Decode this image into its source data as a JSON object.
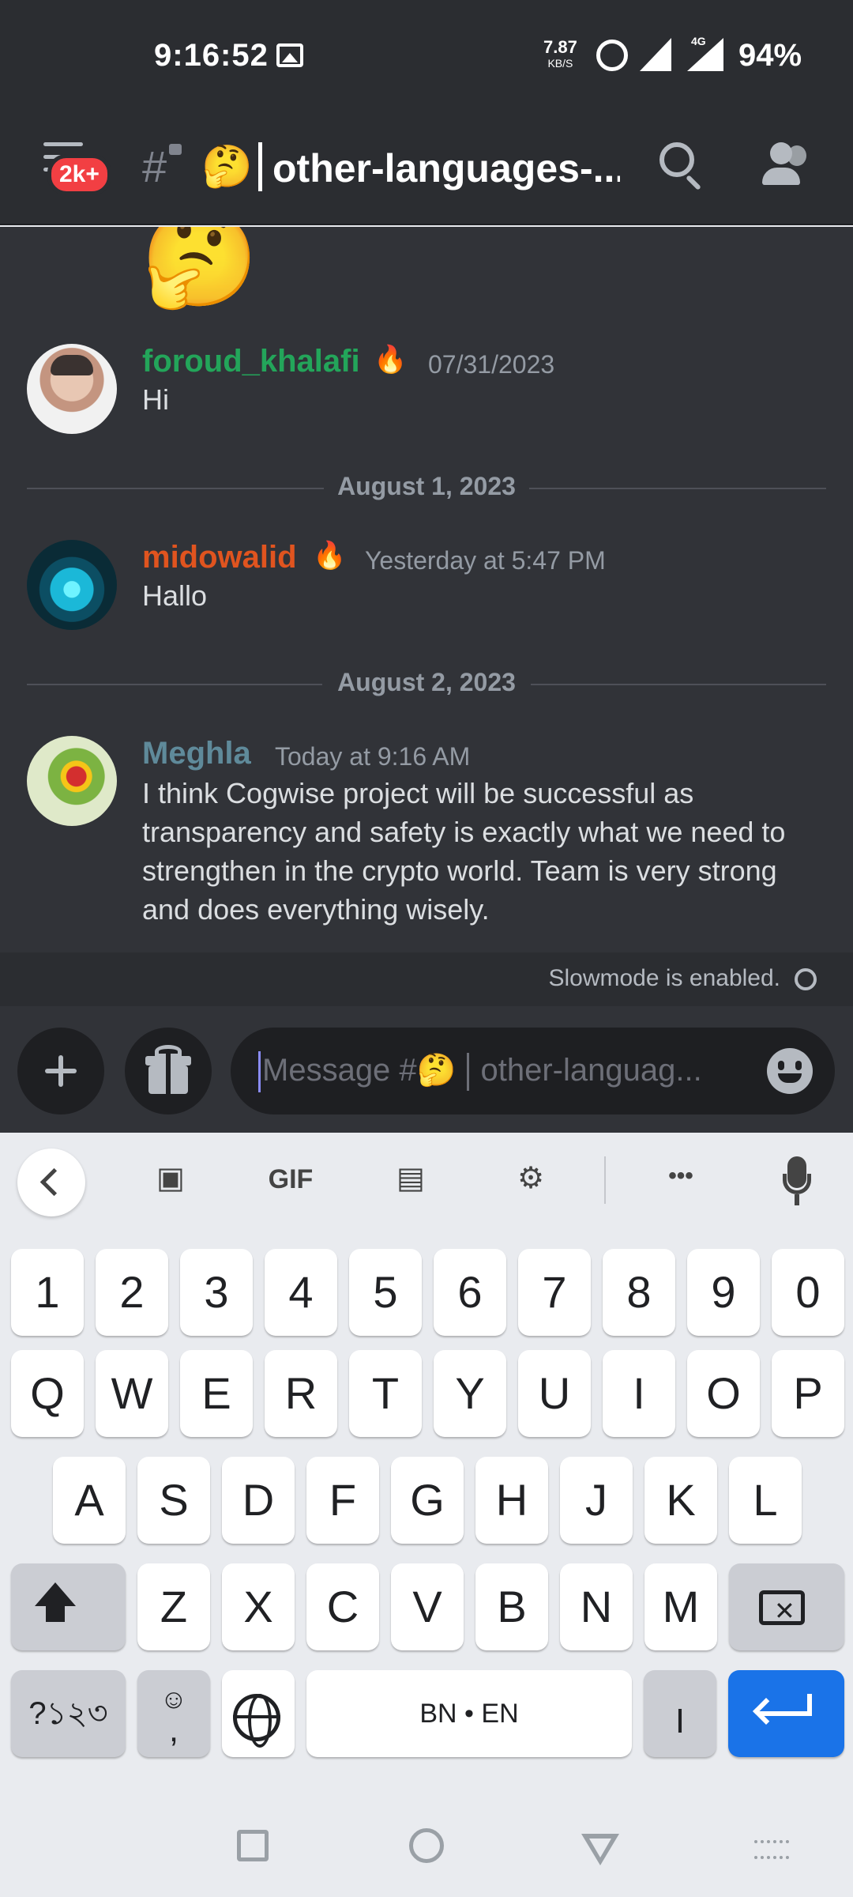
{
  "status_bar": {
    "time": "9:16:52",
    "net_speed": "7.87",
    "net_unit": "KB/S",
    "network_type": "4G",
    "battery": "94%",
    "icons": [
      "gallery-icon",
      "alarm-icon",
      "signal-icon",
      "signal-4g-icon"
    ]
  },
  "header": {
    "notification_badge": "2k+",
    "channel_emoji": "🤔",
    "channel_name": "other-languages-...",
    "icons": [
      "menu-icon",
      "locked-channel-icon",
      "search-icon",
      "members-icon"
    ]
  },
  "chat": {
    "top_emoji": "🤔",
    "separators": [
      "August 1, 2023",
      "August 2, 2023"
    ],
    "messages": [
      {
        "author": "foroud_khalafi",
        "badge": "🔥",
        "timestamp": "07/31/2023",
        "text": "Hi",
        "author_color": "#23a55a"
      },
      {
        "author": "midowalid",
        "badge": "🔥",
        "timestamp": "Yesterday at 5:47 PM",
        "text": "Hallo",
        "author_color": "#e0541f"
      },
      {
        "author": "Meghla",
        "badge": "",
        "timestamp": "Today at 9:16 AM",
        "text": "I think Cogwise project will be successful as transparency and safety is exactly what we need to strengthen in the crypto world. Team is very strong and does everything wisely.",
        "author_color": "#5f8a9a"
      }
    ]
  },
  "slowmode": {
    "text": "Slowmode is enabled."
  },
  "composer": {
    "placeholder_prefix": "Message #",
    "placeholder_emoji": "🤔",
    "placeholder_channel": "other-languag..."
  },
  "keyboard": {
    "toolbar": [
      "back-icon",
      "sticker-icon",
      "GIF",
      "clipboard-icon",
      "settings-icon",
      "more-icon",
      "mic-icon"
    ],
    "gif_label": "GIF",
    "more_label": "•••",
    "row_numbers": [
      "1",
      "2",
      "3",
      "4",
      "5",
      "6",
      "7",
      "8",
      "9",
      "0"
    ],
    "row_q": [
      "Q",
      "W",
      "E",
      "R",
      "T",
      "Y",
      "U",
      "I",
      "O",
      "P"
    ],
    "row_a": [
      "A",
      "S",
      "D",
      "F",
      "G",
      "H",
      "J",
      "K",
      "L"
    ],
    "row_z": [
      "Z",
      "X",
      "C",
      "V",
      "B",
      "N",
      "M"
    ],
    "symbols_label": "?১২৩",
    "emoji_comma_top": "☺",
    "emoji_comma_bottom": ",",
    "space_label": "BN • EN",
    "period_key": "I"
  },
  "colors": {
    "background": "#313338",
    "header": "#2b2d31",
    "accent_blue": "#1a73e8",
    "badge_red": "#f23f43"
  }
}
